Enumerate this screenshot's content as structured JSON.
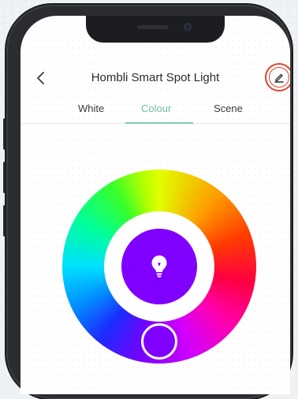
{
  "app": {
    "title": "Hombli Smart Spot Light"
  },
  "header": {
    "back_icon": "chevron-left-icon",
    "edit_icon": "pencil-icon",
    "edit_highlight_color": "#e0442f"
  },
  "tabs": [
    {
      "label": "White",
      "active": false
    },
    {
      "label": "Colour",
      "active": true
    },
    {
      "label": "Scene",
      "active": false
    }
  ],
  "color_picker": {
    "selected_color": "#8000ff",
    "center_icon": "lightbulb-icon",
    "accent_color": "#6fc3a0"
  }
}
